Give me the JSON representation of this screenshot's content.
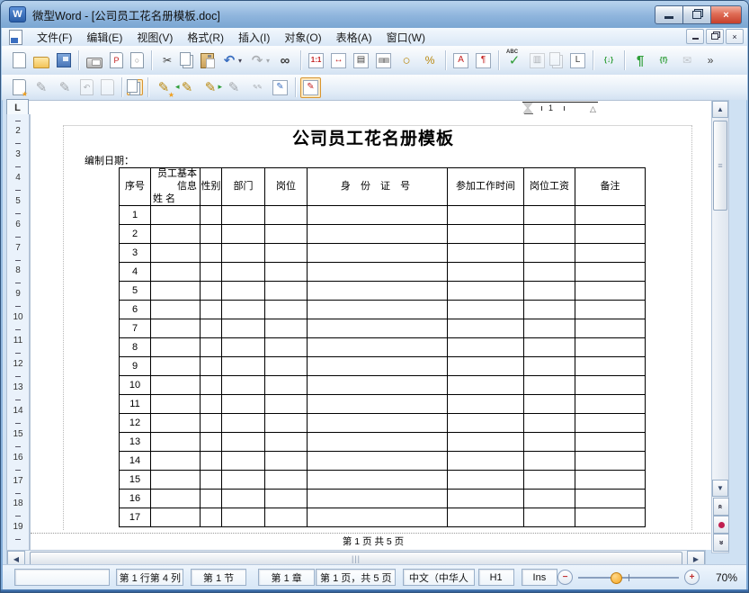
{
  "window": {
    "title": "微型Word - [公司员工花名册模板.doc]",
    "app_initial": "W",
    "buttons": {
      "minimize": "",
      "restore": "",
      "close": "×"
    }
  },
  "menu": {
    "items": [
      {
        "id": "file",
        "label": "文件(F)"
      },
      {
        "id": "edit",
        "label": "编辑(E)"
      },
      {
        "id": "view",
        "label": "视图(V)"
      },
      {
        "id": "format",
        "label": "格式(R)"
      },
      {
        "id": "insert",
        "label": "插入(I)"
      },
      {
        "id": "object",
        "label": "对象(O)"
      },
      {
        "id": "table",
        "label": "表格(A)"
      },
      {
        "id": "window",
        "label": "窗口(W)"
      }
    ],
    "mdi_buttons": {
      "minimize": "",
      "restore": "",
      "close": "×"
    }
  },
  "toolbar_main": {
    "buttons": [
      {
        "id": "new-document",
        "glyph": "",
        "cls": "ic-page"
      },
      {
        "id": "open",
        "glyph": "",
        "cls": "ic-folder"
      },
      {
        "id": "save",
        "glyph": "",
        "cls": "ic-floppy"
      },
      {
        "id": "print",
        "glyph": "",
        "cls": "ic-printer",
        "sep": true
      },
      {
        "id": "export-pdf",
        "glyph": "P",
        "cls": "ic-page red"
      },
      {
        "id": "print-preview",
        "glyph": "○",
        "cls": "ic-page grayc"
      },
      {
        "id": "cut",
        "glyph": "✂",
        "cls": "dark",
        "sep": true
      },
      {
        "id": "copy",
        "glyph": "",
        "cls": "ic-copy"
      },
      {
        "id": "paste",
        "glyph": "",
        "cls": "ic-clip"
      },
      {
        "id": "undo",
        "glyph": "↶",
        "cls": "blue big",
        "dd": true
      },
      {
        "id": "redo",
        "glyph": "↷",
        "cls": "big",
        "disabled": true,
        "dd": true
      },
      {
        "id": "find",
        "glyph": "∞",
        "cls": "dark big"
      },
      {
        "id": "zoom-100",
        "glyph": "1:1",
        "cls": "ic-box red small",
        "sep": true
      },
      {
        "id": "fit-width",
        "glyph": "↔",
        "cls": "ic-box red"
      },
      {
        "id": "one-page-view",
        "glyph": "▤",
        "cls": "ic-box dark"
      },
      {
        "id": "two-page-view",
        "glyph": "▤▤",
        "cls": "ic-box dark tiny"
      },
      {
        "id": "zoom-tool",
        "glyph": "○",
        "cls": "gold big"
      },
      {
        "id": "zoom-percent",
        "glyph": "%",
        "cls": "gold"
      },
      {
        "id": "font",
        "glyph": "A",
        "cls": "ic-box red",
        "sep": true
      },
      {
        "id": "paragraph-settings",
        "glyph": "¶",
        "cls": "ic-box red"
      },
      {
        "id": "spellcheck",
        "glyph": "✓",
        "cls": "green big spell",
        "sep": true
      },
      {
        "id": "columns",
        "glyph": "▥",
        "cls": "ic-box",
        "disabled": true
      },
      {
        "id": "pages",
        "glyph": "",
        "cls": "ic-copy",
        "disabled": true
      },
      {
        "id": "letter-l",
        "glyph": "L",
        "cls": "ic-box dark"
      },
      {
        "id": "braces-down",
        "glyph": "{↓}",
        "cls": "green small",
        "sep": true
      },
      {
        "id": "formatting-marks",
        "glyph": "¶",
        "cls": "green big",
        "sep": true
      },
      {
        "id": "field-codes",
        "glyph": "{f}",
        "cls": "green small"
      },
      {
        "id": "mail",
        "glyph": "✉",
        "cls": "grayc",
        "disabled": true
      },
      {
        "id": "toolbar-overflow",
        "glyph": "»",
        "cls": "dark"
      }
    ]
  },
  "toolbar_review": {
    "buttons": [
      {
        "id": "new-revision",
        "glyph": "",
        "cls": "ic-page star"
      },
      {
        "id": "edit-revision",
        "glyph": "✎",
        "cls": "dark big",
        "disabled": true
      },
      {
        "id": "delete-revision",
        "glyph": "✎",
        "cls": "dark big",
        "disabled": true
      },
      {
        "id": "revert-revision",
        "glyph": "↶",
        "cls": "ic-page",
        "disabled": true
      },
      {
        "id": "revision-page",
        "glyph": "",
        "cls": "ic-page",
        "disabled": true
      },
      {
        "id": "copies",
        "glyph": "",
        "cls": "ic-copy",
        "sel": true,
        "sep": true
      },
      {
        "id": "pencil-new",
        "glyph": "✎",
        "cls": "gold big star2",
        "sep": true
      },
      {
        "id": "pencil-prev",
        "glyph": "✎",
        "cls": "gold big arrl"
      },
      {
        "id": "pencil-next",
        "glyph": "✎",
        "cls": "gold big arrr"
      },
      {
        "id": "pencil-reject",
        "glyph": "✎",
        "cls": "dark big",
        "disabled": true
      },
      {
        "id": "pencil-reject-all",
        "glyph": "✎✎",
        "cls": "dark tiny",
        "disabled": true
      },
      {
        "id": "notes",
        "glyph": "✎",
        "cls": "ic-box blue"
      },
      {
        "id": "notes-panel",
        "glyph": "✎",
        "cls": "ic-box red",
        "sel": true,
        "sep": true
      }
    ]
  },
  "ruler": {
    "tab_selector": "L",
    "h_number": "1",
    "vertical": [
      "2",
      "3",
      "4",
      "5",
      "6",
      "7",
      "8",
      "9",
      "10",
      "11",
      "12",
      "13",
      "14",
      "15",
      "16",
      "17",
      "18",
      "19"
    ]
  },
  "document": {
    "title": "公司员工花名册模板",
    "date_label": "编制日期：",
    "footer": "第 1 页 共 5 页",
    "table": {
      "headers": {
        "seq": "序号",
        "info_group_top": "员工基本",
        "info_group_bottom": "信息",
        "name": "姓  名",
        "gender": "性别",
        "dept": "部门",
        "post": "岗位",
        "id_number": "身 份 证 号",
        "start_date": "参加工作时间",
        "salary": "岗位工资",
        "remark": "备注"
      },
      "row_numbers": [
        "1",
        "2",
        "3",
        "4",
        "5",
        "6",
        "7",
        "8",
        "9",
        "10",
        "11",
        "12",
        "13",
        "14",
        "15",
        "16",
        "17"
      ],
      "empty_columns": 8
    }
  },
  "status_bar": {
    "line_col": "第 1 行第 4 列",
    "section": "第 1 节",
    "chapter": "第 1 章",
    "page_info": "第 1 页，共 5 页",
    "language": "中文（中华人",
    "style_tag": "H1",
    "insert_mode": "Ins",
    "zoom_out": "−",
    "zoom_in": "+",
    "zoom_level": "70%"
  }
}
